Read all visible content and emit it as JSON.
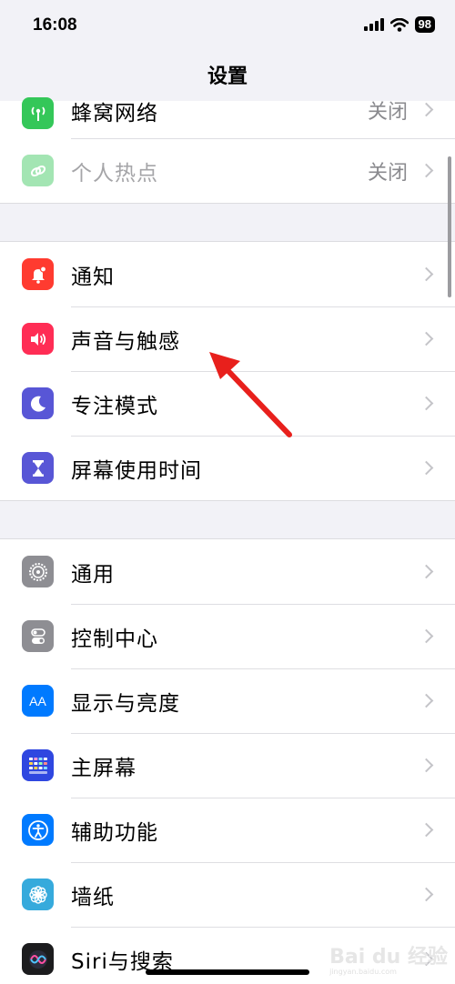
{
  "status_bar": {
    "time": "16:08",
    "battery": "98"
  },
  "nav": {
    "title": "设置"
  },
  "groups": [
    {
      "rows": [
        {
          "label": "蜂窝网络",
          "value": "关闭",
          "icon": "cellular-icon",
          "color": "#34c759"
        },
        {
          "label": "个人热点",
          "value": "关闭",
          "icon": "hotspot-icon",
          "color": "#34c759"
        }
      ]
    },
    {
      "rows": [
        {
          "label": "通知",
          "icon": "bell-icon",
          "color": "#ff3b30"
        },
        {
          "label": "声音与触感",
          "icon": "speaker-icon",
          "color": "#ff2d55"
        },
        {
          "label": "专注模式",
          "icon": "moon-icon",
          "color": "#5856d6"
        },
        {
          "label": "屏幕使用时间",
          "icon": "hourglass-icon",
          "color": "#5856d6"
        }
      ]
    },
    {
      "rows": [
        {
          "label": "通用",
          "icon": "gear-icon",
          "color": "#8e8e93"
        },
        {
          "label": "控制中心",
          "icon": "toggles-icon",
          "color": "#8e8e93"
        },
        {
          "label": "显示与亮度",
          "icon_text": "AA",
          "icon": "display-icon",
          "color": "#007aff"
        },
        {
          "label": "主屏幕",
          "icon": "home-screen-icon",
          "color": "#2f47e0"
        },
        {
          "label": "辅助功能",
          "icon": "accessibility-icon",
          "color": "#007aff"
        },
        {
          "label": "墙纸",
          "icon": "flower-icon",
          "color": "#36aadc"
        },
        {
          "label": "Siri与搜索",
          "icon": "siri-icon",
          "color": "#1c1c1e"
        }
      ]
    }
  ],
  "watermark": {
    "brand": "Bai du 经验",
    "url": "jingyan.baidu.com"
  },
  "annotation": {
    "color": "#e8201c",
    "target": "声音与触感"
  }
}
